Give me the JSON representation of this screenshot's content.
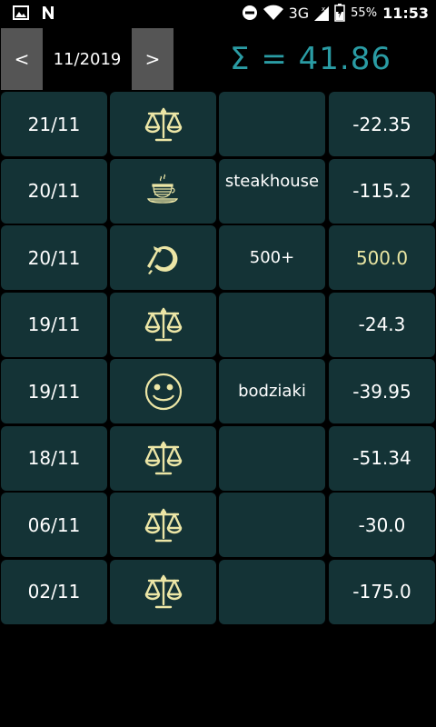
{
  "status_bar": {
    "network": "3G",
    "battery": "55%",
    "time": "11:53"
  },
  "header": {
    "prev_label": "<",
    "month": "11/2019",
    "next_label": ">",
    "sum": "Σ = 41.86"
  },
  "colors": {
    "background": "#000000",
    "cell": "#143336",
    "sum_text": "#2a9ca4",
    "positive_amount": "#e9e6a3",
    "icon": "#ece6a6",
    "nav_button": "#555555"
  },
  "rows": [
    {
      "date": "21/11",
      "icon": "scales-icon",
      "note": "",
      "amount": "-22.35"
    },
    {
      "date": "20/11",
      "icon": "coffee-cup-icon",
      "note": "steakhouse",
      "amount": "-115.2"
    },
    {
      "date": "20/11",
      "icon": "hammer-sickle-icon",
      "note": "500+",
      "amount": "500.0"
    },
    {
      "date": "19/11",
      "icon": "scales-icon",
      "note": "",
      "amount": "-24.3"
    },
    {
      "date": "19/11",
      "icon": "smiley-icon",
      "note": "bodziaki",
      "amount": "-39.95"
    },
    {
      "date": "18/11",
      "icon": "scales-icon",
      "note": "",
      "amount": "-51.34"
    },
    {
      "date": "06/11",
      "icon": "scales-icon",
      "note": "",
      "amount": "-30.0"
    },
    {
      "date": "02/11",
      "icon": "scales-icon",
      "note": "",
      "amount": "-175.0"
    }
  ]
}
